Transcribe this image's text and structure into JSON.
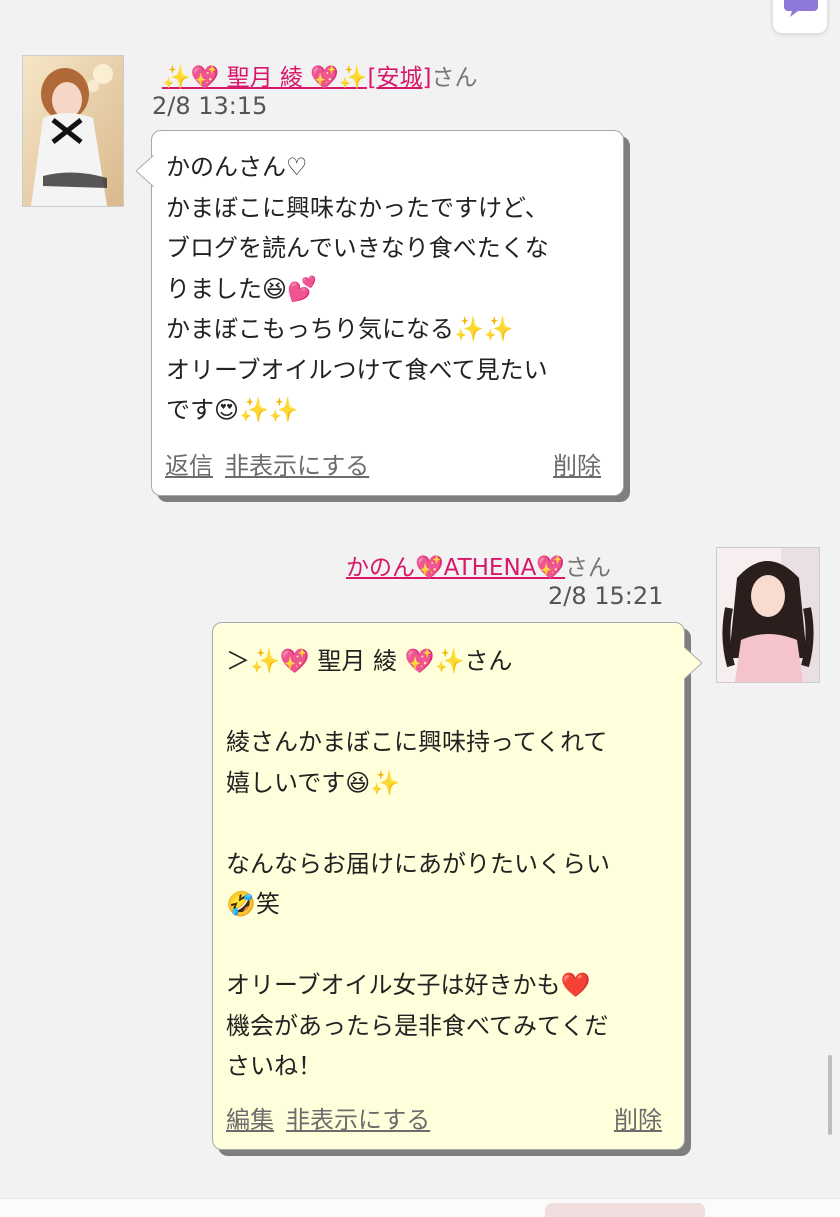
{
  "colors": {
    "name_accent": "#d8176b",
    "received_bubble": "#ffffff",
    "sent_bubble": "#ffffdc",
    "action_link": "#6c6c6c"
  },
  "top_button": {
    "icon": "chat-bubble-icon"
  },
  "messages": [
    {
      "sender_name": "✨💖 聖月 綾 💖✨[安城]",
      "honorific": "さん",
      "timestamp": "2/8 13:15",
      "text": "かのんさん♡\nかまぼこに興味なかったですけど、\nブログを読んでいきなり食べたくな\nりました😆💕\nかまぼこもっちり気になる✨✨\nオリーブオイルつけて食べて見たい\nです😍✨✨",
      "actions": {
        "primary": "返信",
        "secondary": "非表示にする",
        "delete": "削除"
      }
    },
    {
      "sender_name": "かのん💖ATHENA💖",
      "honorific": "さん",
      "timestamp": "2/8 15:21",
      "text": "＞✨💖 聖月 綾 💖✨さん\n\n綾さんかまぼこに興味持ってくれて\n嬉しいです😆✨\n\nなんならお届けにあがりたいくらい\n🤣笑\n\nオリーブオイル女子は好きかも❤️\n機会があったら是非食べてみてくだ\nさいね！",
      "actions": {
        "primary": "編集",
        "secondary": "非表示にする",
        "delete": "削除"
      }
    }
  ]
}
